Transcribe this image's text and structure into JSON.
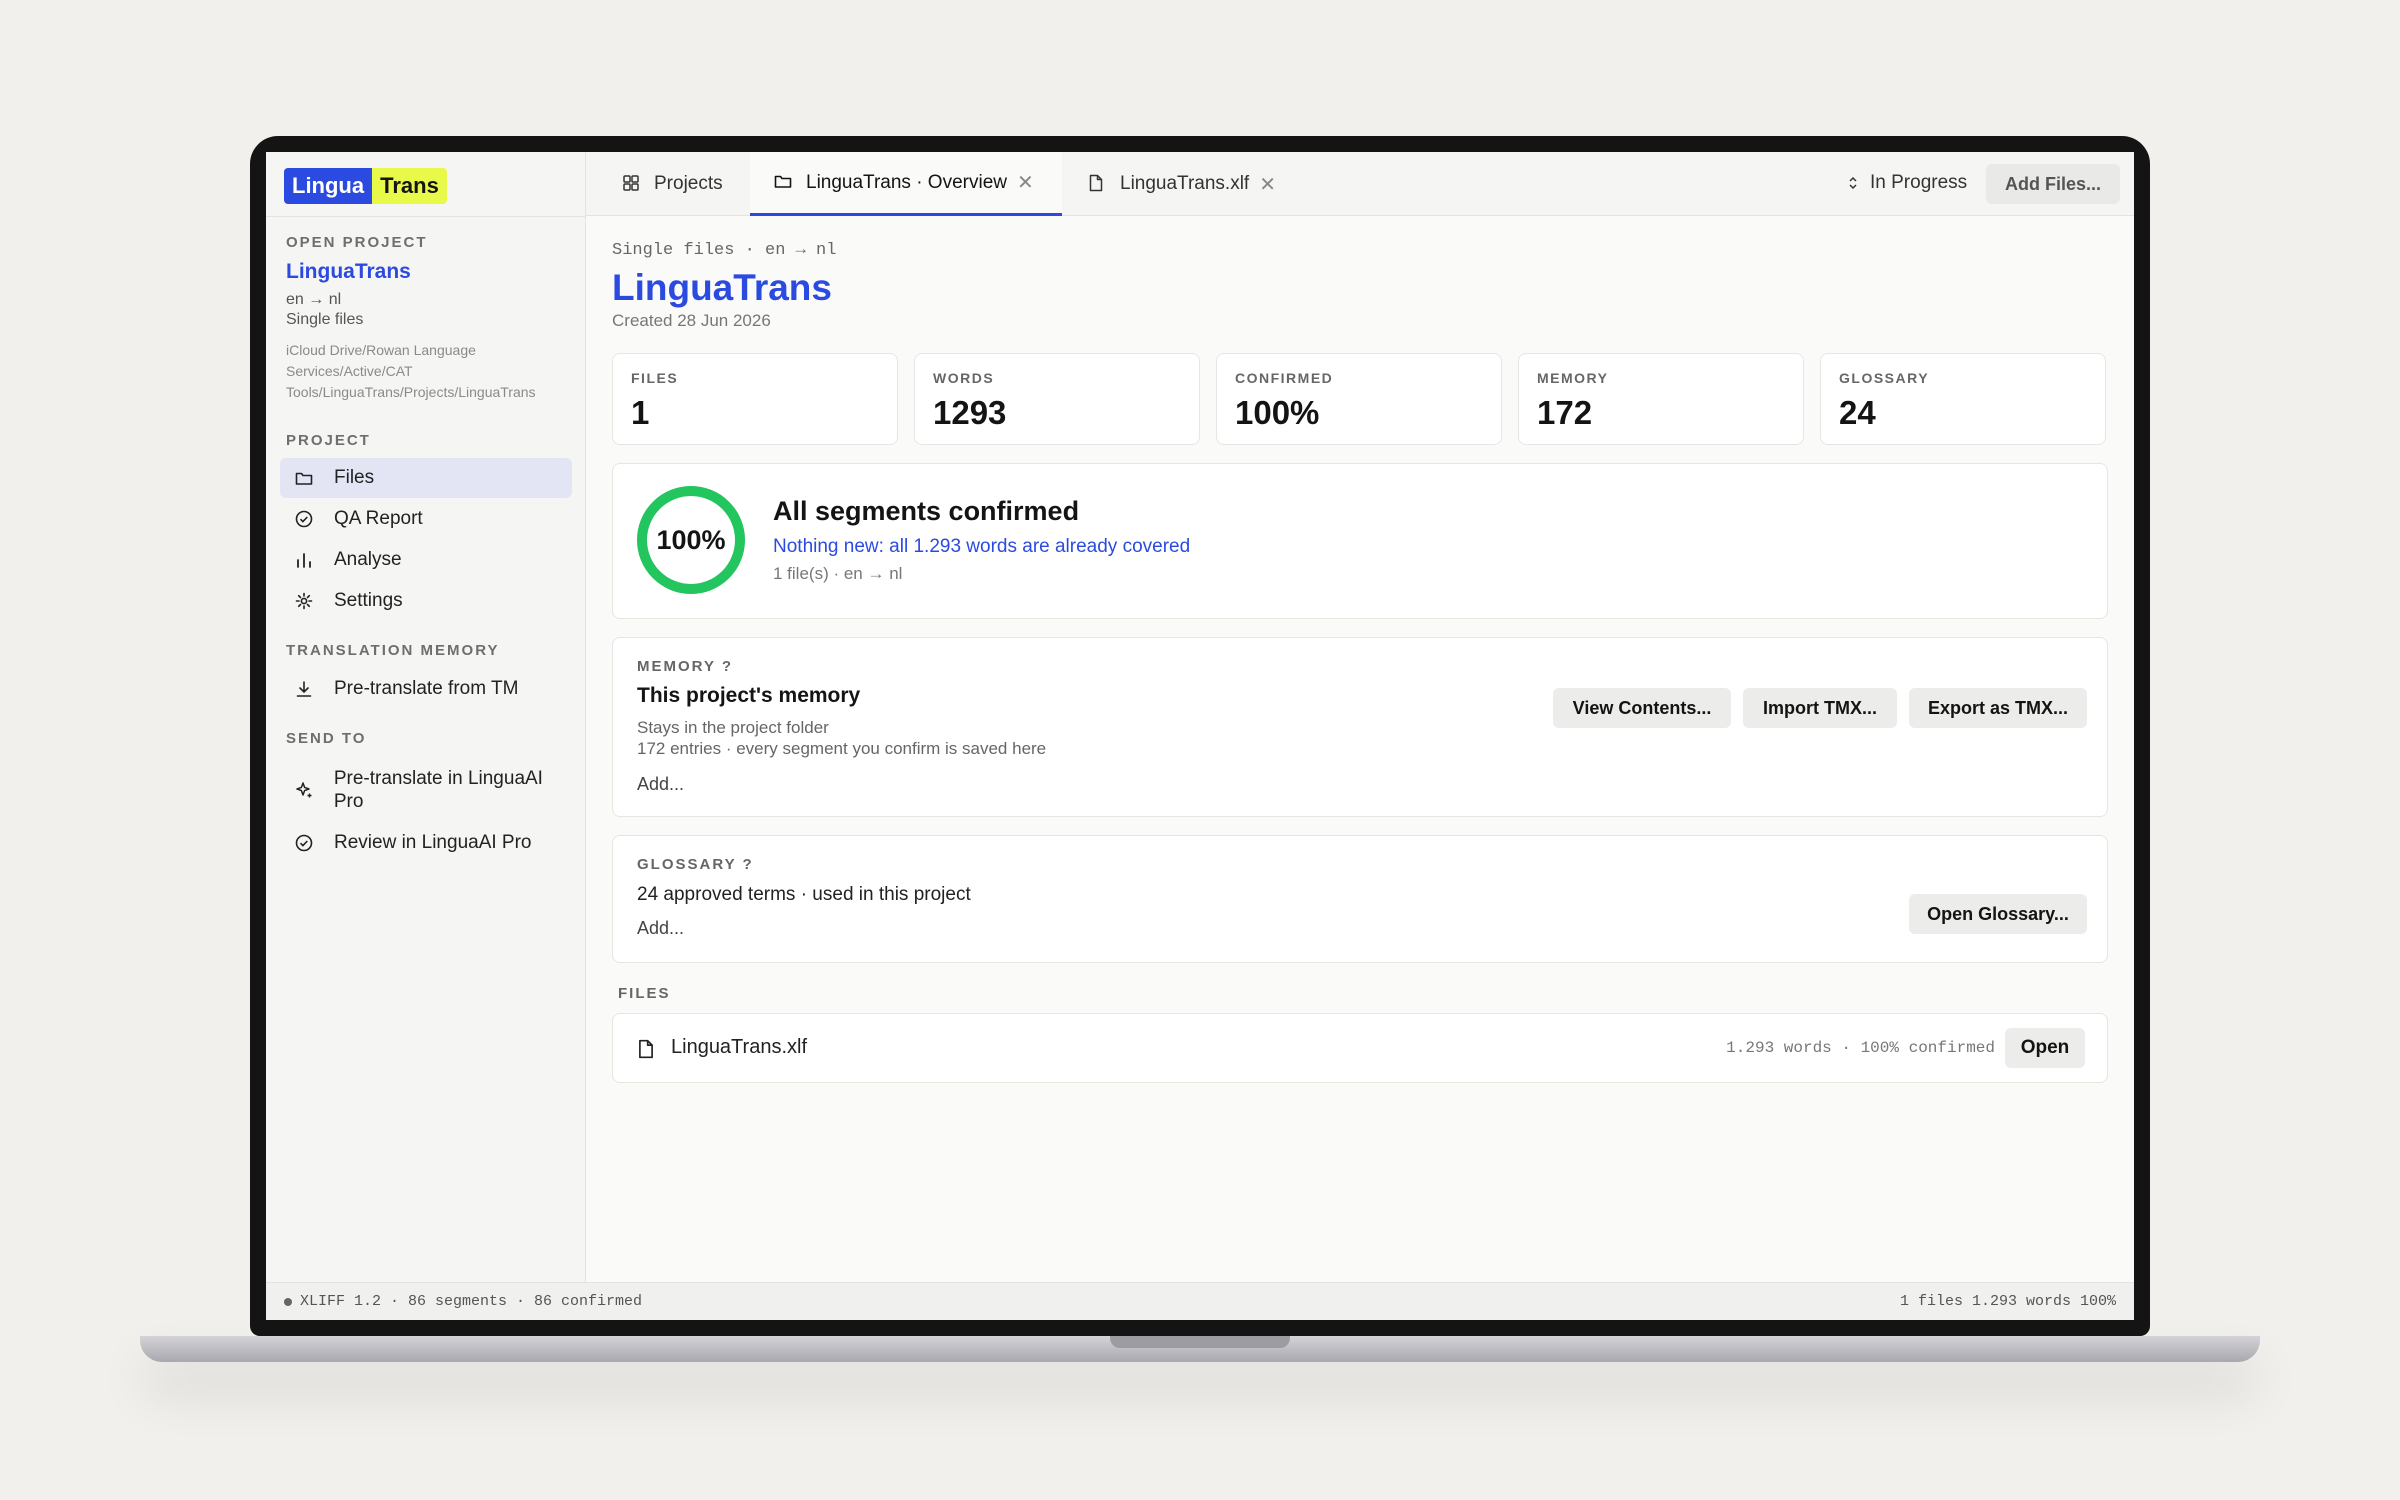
{
  "app": {
    "logo_part1": "Lingua",
    "logo_part2": "Trans"
  },
  "sidebar": {
    "open_project_label": "OPEN PROJECT",
    "project_name": "LinguaTrans",
    "languages": "en → nl",
    "type": "Single files",
    "path": "iCloud Drive/Rowan Language Services/Active/CAT Tools/LinguaTrans/Projects/LinguaTrans",
    "project_section": "PROJECT",
    "project_items": [
      {
        "label": "Files",
        "icon": "folder-icon"
      },
      {
        "label": "QA Report",
        "icon": "check-circle-icon"
      },
      {
        "label": "Analyse",
        "icon": "bar-chart-icon"
      },
      {
        "label": "Settings",
        "icon": "gear-icon"
      }
    ],
    "tm_section": "TRANSLATION MEMORY",
    "tm_items": [
      {
        "label": "Pre-translate from TM",
        "icon": "download-icon"
      }
    ],
    "send_section": "SEND TO",
    "send_items": [
      {
        "label": "Pre-translate in LinguaAI Pro",
        "icon": "sparkle-icon"
      },
      {
        "label": "Review in LinguaAI Pro",
        "icon": "check-circle-icon"
      }
    ]
  },
  "tabs": [
    {
      "label": "Projects",
      "icon": "grid-icon",
      "active": false
    },
    {
      "label": "LinguaTrans · Overview",
      "icon": "folder-icon",
      "active": true,
      "closable": true
    },
    {
      "label": "LinguaTrans.xlf",
      "icon": "file-icon",
      "active": false,
      "closable": true
    }
  ],
  "header": {
    "status": "In Progress",
    "add_files": "Add Files..."
  },
  "main": {
    "breadcrumb": "Single files · en → nl",
    "title": "LinguaTrans",
    "created": "Created 28 Jun 2026",
    "stats": [
      {
        "label": "FILES",
        "value": "1"
      },
      {
        "label": "WORDS",
        "value": "1293"
      },
      {
        "label": "CONFIRMED",
        "value": "100%"
      },
      {
        "label": "MEMORY",
        "value": "172"
      },
      {
        "label": "GLOSSARY",
        "value": "24"
      }
    ],
    "confirmation": {
      "percent_text": "100%",
      "progress": 1.0,
      "title": "All segments confirmed",
      "subtitle": "Nothing new: all 1.293 words are already covered",
      "meta": "1 file(s) · en → nl"
    },
    "memory": {
      "label": "MEMORY ?",
      "title": "This project's memory",
      "line1": "Stays in the project folder",
      "line2": "172 entries · every segment you confirm is saved here",
      "add": "Add...",
      "buttons": [
        "View Contents...",
        "Import TMX...",
        "Export as TMX..."
      ]
    },
    "glossary": {
      "label": "GLOSSARY ?",
      "text": "24 approved terms · used in this project",
      "add": "Add...",
      "button": "Open Glossary..."
    },
    "files_label": "FILES",
    "files": [
      {
        "name": "LinguaTrans.xlf",
        "meta": "1.293 words · 100% confirmed",
        "action": "Open"
      }
    ]
  },
  "statusbar": {
    "left": "XLIFF 1.2 · 86 segments · 86 confirmed",
    "right": "1 files 1.293 words 100%"
  },
  "colors": {
    "accent": "#2b4be0",
    "logo_highlight": "#e9f94a",
    "success": "#22c55e"
  }
}
